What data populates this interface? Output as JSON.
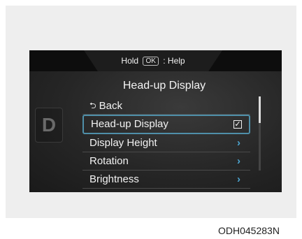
{
  "header": {
    "hold_label": "Hold",
    "ok_key": "OK",
    "help_label": ": Help"
  },
  "drive_indicator": "D",
  "menu_title": "Head-up Display",
  "menu": {
    "back_label": "Back",
    "items": [
      {
        "label": "Head-up Display",
        "control": "checkbox",
        "checked": true
      },
      {
        "label": "Display Height",
        "control": "chevron"
      },
      {
        "label": "Rotation",
        "control": "chevron"
      },
      {
        "label": "Brightness",
        "control": "chevron"
      }
    ]
  },
  "figure_code": "ODH045283N",
  "colors": {
    "selection_border": "#4f8fa9",
    "chevron": "#4ca6d2"
  }
}
